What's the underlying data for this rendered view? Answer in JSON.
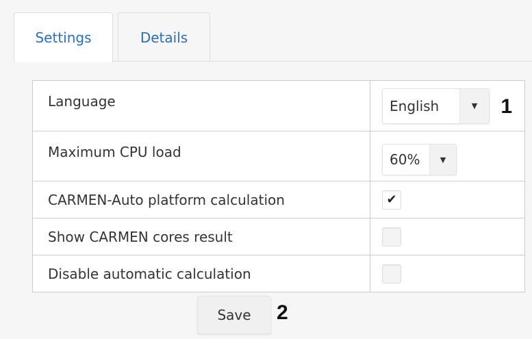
{
  "tabs": [
    {
      "label": "Settings",
      "active": true
    },
    {
      "label": "Details",
      "active": false
    }
  ],
  "settings": {
    "rows": [
      {
        "label": "Language",
        "control": "select",
        "value": "English"
      },
      {
        "label": "Maximum CPU load",
        "control": "select",
        "value": "60%"
      },
      {
        "label": "CARMEN-Auto platform calculation",
        "control": "checkbox",
        "checked": true
      },
      {
        "label": "Show CARMEN cores result",
        "control": "checkbox",
        "checked": false
      },
      {
        "label": "Disable automatic calculation",
        "control": "checkbox",
        "checked": false
      }
    ]
  },
  "icons": {
    "dropdown": "caret-down-icon",
    "check": "checkmark-icon"
  },
  "callouts": {
    "language": "1",
    "save": "2"
  },
  "actions": {
    "save_label": "Save"
  },
  "colors": {
    "tab_text": "#2a6ebb",
    "border": "#cccccc",
    "background": "#f6f6f6"
  }
}
